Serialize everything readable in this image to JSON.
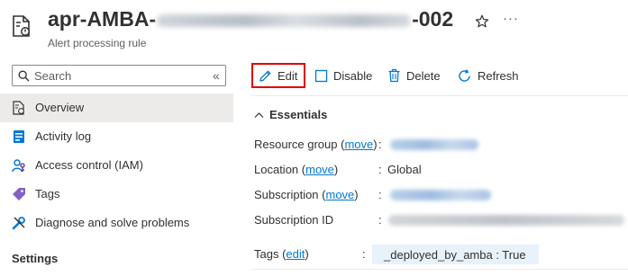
{
  "header": {
    "title_prefix": "apr-AMBA-",
    "title_suffix": "-002",
    "subtitle": "Alert processing rule",
    "icons": {
      "resource": "alert-processing-rule-icon",
      "favorite": "star-icon",
      "more": "more-icon"
    },
    "more_glyph": "···"
  },
  "nav": {
    "search_placeholder": "Search",
    "collapse_glyph": "«",
    "items": [
      {
        "label": "Overview",
        "icon": "overview-icon",
        "selected": true
      },
      {
        "label": "Activity log",
        "icon": "activity-log-icon",
        "selected": false
      },
      {
        "label": "Access control (IAM)",
        "icon": "iam-icon",
        "selected": false
      },
      {
        "label": "Tags",
        "icon": "tag-icon",
        "selected": false
      },
      {
        "label": "Diagnose and solve problems",
        "icon": "wrench-icon",
        "selected": false
      }
    ],
    "section_heading": "Settings"
  },
  "toolbar": {
    "edit_label": "Edit",
    "disable_label": "Disable",
    "delete_label": "Delete",
    "refresh_label": "Refresh"
  },
  "essentials": {
    "heading": "Essentials",
    "resource_group_label": "Resource group",
    "location_label": "Location",
    "location_value": "Global",
    "subscription_label": "Subscription",
    "subscription_id_label": "Subscription ID",
    "tags_label": "Tags",
    "move_link": "move",
    "edit_link": "edit",
    "colon": ":",
    "tag_value": "_deployed_by_amba : True"
  },
  "colors": {
    "accent": "#0078d4",
    "highlight_border": "#e00000",
    "selected_bg": "#edebe9",
    "tag_chip_bg": "#e8f2fb"
  }
}
